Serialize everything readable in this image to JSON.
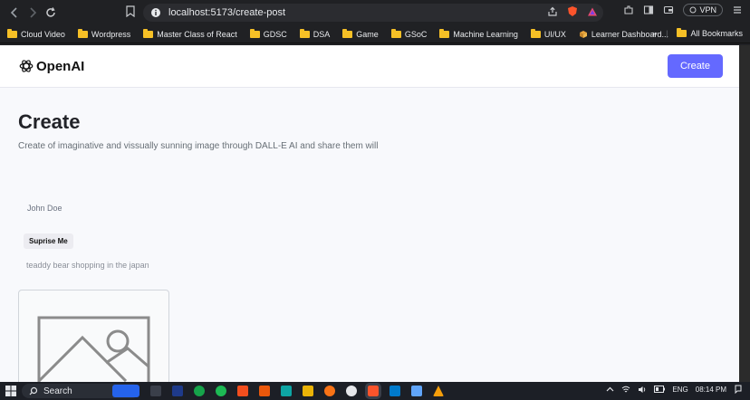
{
  "browser": {
    "url": "localhost:5173/create-post",
    "vpn_label": "VPN",
    "bookmarks": [
      {
        "label": "Cloud Video"
      },
      {
        "label": "Wordpress"
      },
      {
        "label": "Master Class of React"
      },
      {
        "label": "GDSC"
      },
      {
        "label": "DSA"
      },
      {
        "label": "Game"
      },
      {
        "label": "GSoC"
      },
      {
        "label": "Machine Learning"
      },
      {
        "label": "UI/UX"
      },
      {
        "label": "Learner Dashboard..."
      }
    ],
    "more_bookmarks": "»",
    "all_bookmarks": "All Bookmarks"
  },
  "header": {
    "logo_text": "OpenAI",
    "create_button": "Create"
  },
  "main": {
    "title": "Create",
    "subtitle": "Create of imaginative and vissually sunning image through DALL-E AI and share them will",
    "name_value": "John Doe",
    "surprise_button": "Suprise Me",
    "prompt_value": "teaddy bear shopping in the japan"
  },
  "taskbar": {
    "search_label": "Search",
    "language": "ENG",
    "time": "08:14 PM"
  },
  "colors": {
    "accent": "#6469ff",
    "page_bg": "#f8f9fc",
    "folder": "#f6c026"
  }
}
